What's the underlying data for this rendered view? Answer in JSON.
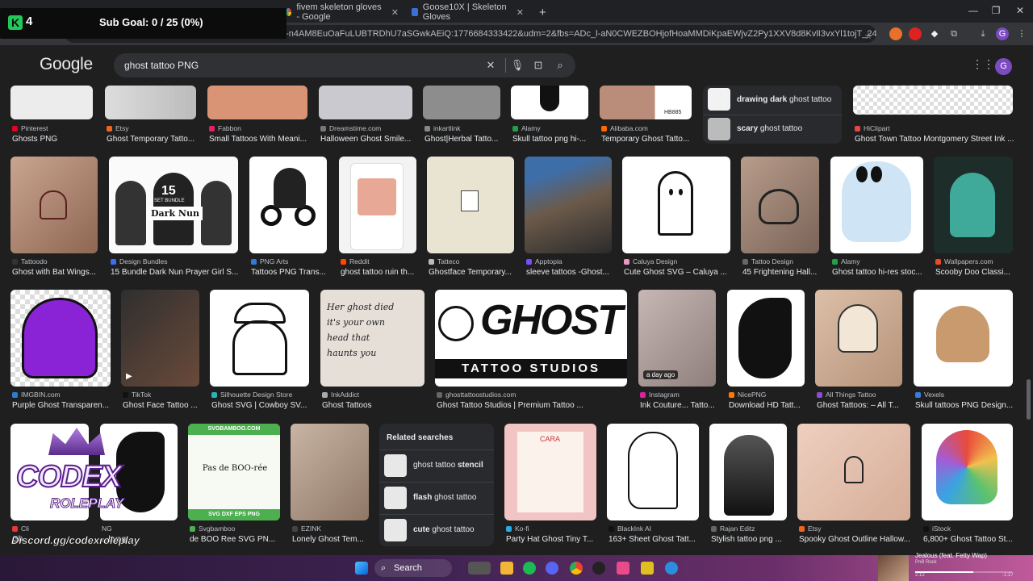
{
  "browser": {
    "tabs": [
      {
        "label": "fivem skeleton gloves - Google"
      },
      {
        "label": "Goose10X | Skeleton Gloves"
      }
    ],
    "new_tab": "+",
    "url": "L-n4AM8EuOaFuLUBTRDhU7aSGwkAEiQ:1776684333422&udm=2&fbs=ADc_l-aN0CWEZBOHjofHoaMMDiKpaEWjvZ2Py1XXV8d8KvlI3vxYl1tojT_24H7Q4iMwclSJUz4FcZO..."
  },
  "overlay": {
    "count": "4",
    "subgoal": "Sub Goal: 0 / 25 (0%)"
  },
  "google": {
    "logo": "Google",
    "query": "ghost tattoo PNG",
    "avatar": "G"
  },
  "row1": [
    {
      "src": "Pinterest",
      "title": "Ghosts PNG"
    },
    {
      "src": "Etsy",
      "title": "Ghost Temporary Tatto..."
    },
    {
      "src": "Fabbon",
      "title": "Small Tattoos With Meani..."
    },
    {
      "src": "Dreamstime.com",
      "title": "Halloween Ghost Smile..."
    },
    {
      "src": "inkartlink",
      "title": "Ghost|Herbal Tatto..."
    },
    {
      "src": "Alamy",
      "title": "Skull tattoo png hi-..."
    },
    {
      "src": "Alibaba.com",
      "title": "Temporary Ghost Tatto..."
    },
    {
      "src": "HiClipart",
      "title": "Ghost Town Tattoo Montgomery Street Ink ..."
    }
  ],
  "row1_related": [
    {
      "bold": "drawing dark",
      "rest": " ghost tattoo"
    },
    {
      "bold": "scary",
      "rest": " ghost tattoo"
    }
  ],
  "row1_badge": "HB885",
  "row2": [
    {
      "src": "Tattoodo",
      "title": "Ghost with Bat Wings..."
    },
    {
      "src": "Design Bundles",
      "title": "15 Bundle Dark Nun Prayer Girl S..."
    },
    {
      "src": "PNG Arts",
      "title": "Tattoos PNG Trans..."
    },
    {
      "src": "Reddit",
      "title": "ghost tattoo ruin th..."
    },
    {
      "src": "Tatteco",
      "title": "Ghostface Temporary..."
    },
    {
      "src": "Apptopia",
      "title": "sleeve tattoos -Ghost..."
    },
    {
      "src": "Caluya Design",
      "title": "Cute Ghost SVG – Caluya ..."
    },
    {
      "src": "Tattoo Design",
      "title": "45 Frightening Hall..."
    },
    {
      "src": "Alamy",
      "title": "Ghost tattoo hi-res stoc..."
    },
    {
      "src": "Wallpapers.com",
      "title": "Scooby Doo Classi..."
    }
  ],
  "row2_texts": {
    "bundle_num": "15",
    "bundle_set": "SET BUNDLE",
    "bundle_name": "Dark Nun"
  },
  "row3": [
    {
      "src": "IMGBIN.com",
      "title": "Purple Ghost Transparen..."
    },
    {
      "src": "TikTok",
      "title": "Ghost Face Tattoo ..."
    },
    {
      "src": "Silhouette Design Store",
      "title": "Ghost SVG | Cowboy SV..."
    },
    {
      "src": "InkAddict",
      "title": "Ghost Tattoos"
    },
    {
      "src": "ghosttattoostudios.com",
      "title": "Ghost Tattoo Studios | Premium Tattoo ..."
    },
    {
      "src": "Instagram",
      "title": "Ink Couture... Tatto..."
    },
    {
      "src": "NicePNG",
      "title": "Download HD Tatt..."
    },
    {
      "src": "All Things Tattoo",
      "title": "Ghost Tattoos: – All T..."
    },
    {
      "src": "Vexels",
      "title": "Skull tattoos PNG Design..."
    }
  ],
  "row3_texts": {
    "handwriting": "Her ghost died it's your own head that haunts you",
    "studio_big": "GHOST",
    "studio_small": "TATTOO STUDIOS",
    "age_badge": "a day ago"
  },
  "row4": [
    {
      "src": "Cli",
      "title": "Gh"
    },
    {
      "src": "NG",
      "title": "...byag..."
    },
    {
      "src": "Svgbamboo",
      "title": "de BOO Ree SVG PN..."
    },
    {
      "src": "EZINK",
      "title": "Lonely Ghost Tem..."
    },
    {
      "src": "Ko-fi",
      "title": "Party Hat Ghost Tiny T..."
    },
    {
      "src": "BlackInk AI",
      "title": "163+ Sheet Ghost Tatt..."
    },
    {
      "src": "Rajan Editz",
      "title": "Stylish tattoo png ..."
    },
    {
      "src": "Etsy",
      "title": "Spooky Ghost Outline Hallow..."
    },
    {
      "src": "iStock",
      "title": "6,800+ Ghost Tattoo St..."
    }
  ],
  "row4_texts": {
    "boo_brand": "SVGBAMBOO.COM",
    "boo_text": "Pas de BOO-rée",
    "boo_formats": "SVG   DXF   EPS   PNG",
    "kofi_name": "CARA"
  },
  "related": {
    "heading": "Related searches",
    "items": [
      {
        "plain": "ghost tattoo ",
        "bold": "stencil"
      },
      {
        "bold": "flash",
        "plain": " ghost tattoo"
      },
      {
        "bold": "cute",
        "plain": " ghost tattoo"
      }
    ]
  },
  "codex": {
    "name": "CODEX",
    "sub": "ROLEPLAY",
    "discord": "Discord.gg/codexroleplay"
  },
  "taskbar": {
    "search": "Search",
    "media_title": "Jealous (feat. Fetty Wap)",
    "media_artist": "PnB Rock",
    "media_time": "2:12",
    "media_remaining": "-1:27"
  },
  "colors": {
    "bg": "#1f1f1f",
    "accent": "#7b4bbf",
    "purple_ghost": "#8a22d6"
  }
}
